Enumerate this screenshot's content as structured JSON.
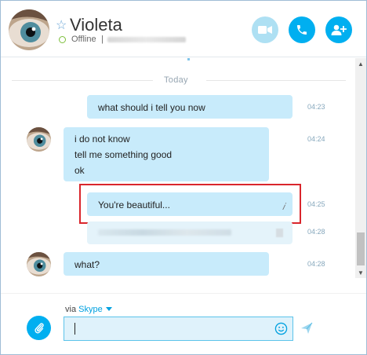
{
  "contact": {
    "name": "Violeta",
    "status": "Offline",
    "separator": "|"
  },
  "chat": {
    "date_divider": "Today",
    "messages": [
      {
        "text": [
          "what should i tell you now"
        ],
        "time": "04:23",
        "sender": "me"
      },
      {
        "text": [
          "i do not know",
          "tell me something good",
          "ok"
        ],
        "time": "04:24",
        "sender": "Violeta"
      },
      {
        "text": [
          "You're beautiful..."
        ],
        "time": "04:25",
        "sender": "me",
        "edit_icon": "𝑖"
      },
      {
        "text": [],
        "time": "04:28",
        "sender": "me",
        "redacted": true
      },
      {
        "text": [
          "what?"
        ],
        "time": "04:28",
        "sender": "Violeta"
      }
    ]
  },
  "composer": {
    "via_label": "via",
    "via_link": "Skype",
    "input_value": "",
    "input_placeholder": ""
  },
  "colors": {
    "accent": "#00aff0",
    "bubble": "#c8ebfb",
    "highlight": "#d9262c",
    "online_ring": "#7cbf3a"
  },
  "icons": [
    "star-icon",
    "video-call-icon",
    "phone-call-icon",
    "add-contact-icon",
    "attachment-icon",
    "emoji-icon",
    "send-icon",
    "edit-icon",
    "chevron-down-icon",
    "scroll-up-icon",
    "scroll-down-icon"
  ]
}
